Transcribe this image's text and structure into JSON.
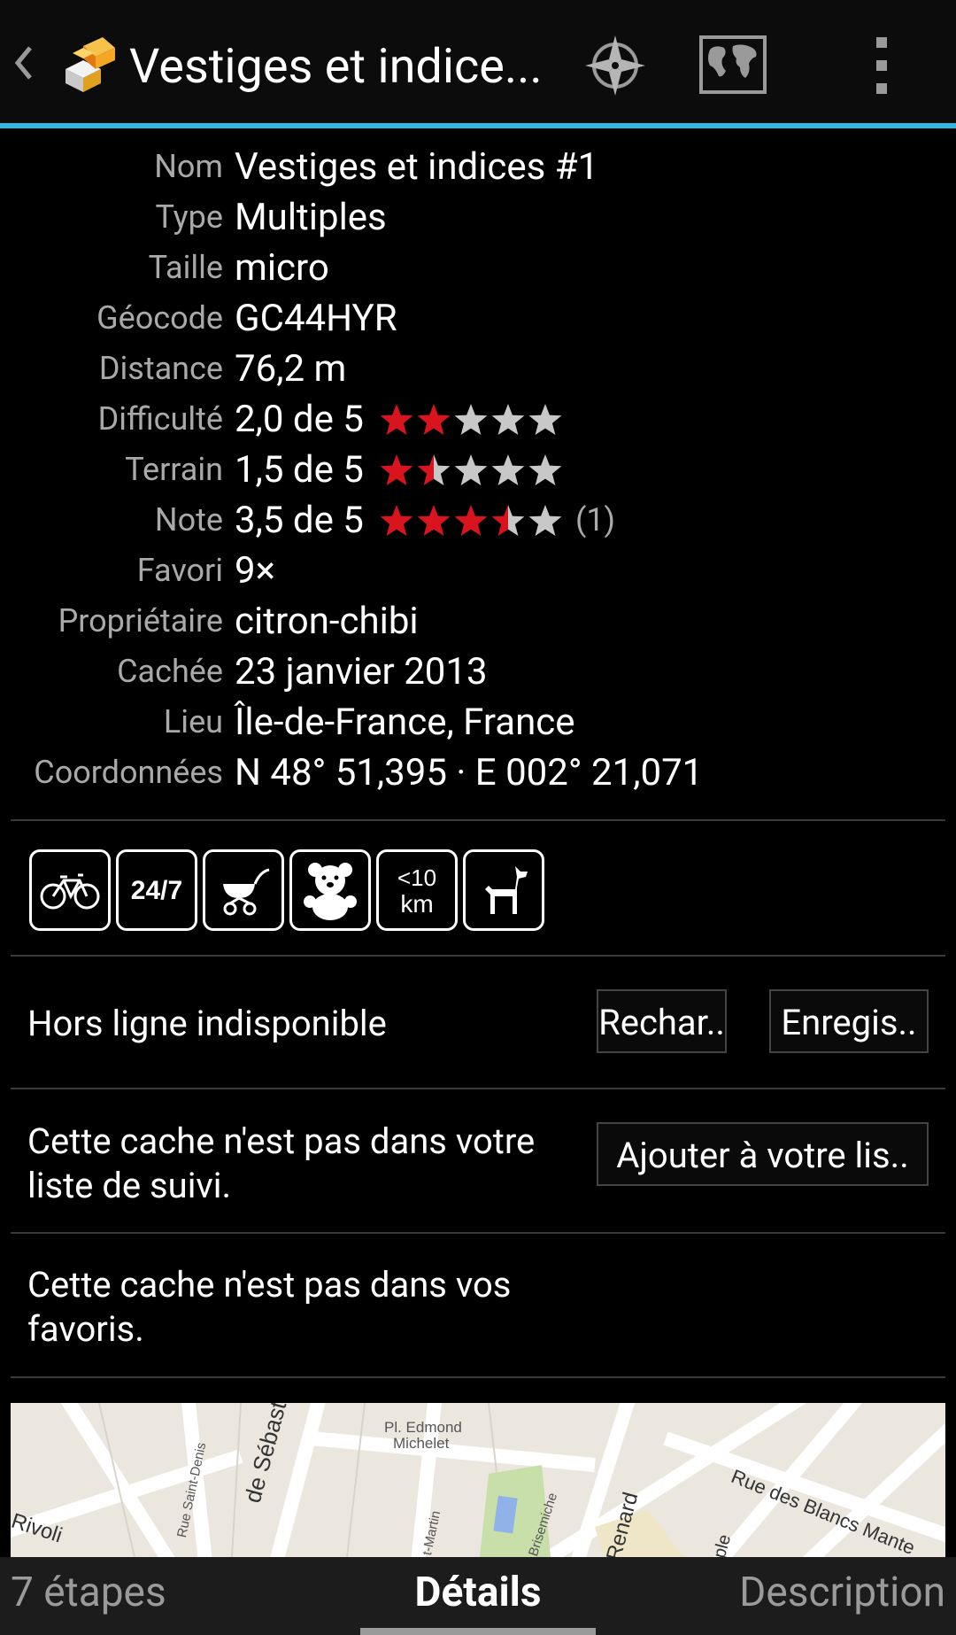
{
  "actionbar": {
    "title": "Vestiges et indice...",
    "icons": [
      "up-arrow-icon",
      "cache-app-icon",
      "compass-icon",
      "map-icon",
      "overflow-menu-icon"
    ]
  },
  "details": [
    {
      "label": "Nom",
      "value": "Vestiges et indices #1"
    },
    {
      "label": "Type",
      "value": "Multiples"
    },
    {
      "label": "Taille",
      "value": "micro"
    },
    {
      "label": "Géocode",
      "value": "GC44HYR"
    },
    {
      "label": "Distance",
      "value": "76,2 m"
    },
    {
      "label": "Difficulté",
      "value": "2,0 de 5",
      "rating": 2.0
    },
    {
      "label": "Terrain",
      "value": "1,5 de 5",
      "rating": 1.5
    },
    {
      "label": "Note",
      "value": "3,5 de 5",
      "rating": 3.5,
      "votes": "(1)"
    },
    {
      "label": "Favori",
      "value": "9×"
    },
    {
      "label": "Propriétaire",
      "value": "citron-chibi"
    },
    {
      "label": "Cachée",
      "value": "23 janvier 2013"
    },
    {
      "label": "Lieu",
      "value": "Île-de-France, France"
    },
    {
      "label": "Coordonnées",
      "value": "N 48° 51,395 · E 002° 21,071"
    }
  ],
  "attributes": [
    {
      "name": "bicycle-icon"
    },
    {
      "name": "24-7-icon",
      "text": "24/7"
    },
    {
      "name": "stroller-icon"
    },
    {
      "name": "teddy-bear-icon"
    },
    {
      "name": "under-10km-icon",
      "text_top": "<10",
      "text_bottom": "km"
    },
    {
      "name": "dog-icon"
    }
  ],
  "offline": {
    "text": "Hors ligne indisponible",
    "reload_label": "Rechar..",
    "save_label": "Enregis.."
  },
  "watchlist": {
    "text_line1": "Cette cache n'est pas dans votre",
    "text_line2": "liste de suivi.",
    "add_label": "Ajouter à votre lis.."
  },
  "favorites": {
    "text_line1": "Cette cache n'est pas dans vos",
    "text_line2": "favoris."
  },
  "map": {
    "labels": [
      "Pl. Edmond",
      "Michelet",
      "de Sébastopol",
      "Rue Saint-Denis",
      "Rivoli",
      "t-Martin",
      "Brisemiche",
      "Renard",
      "Rue des Blancs Mante",
      "ple"
    ]
  },
  "tabs": {
    "left": "7 étapes",
    "center": "Détails",
    "right": "Description"
  },
  "colors": {
    "accent": "#33b5e5",
    "star_on": "#d9141e",
    "star_off": "#c8c8c8",
    "label": "#a9a9a9"
  }
}
